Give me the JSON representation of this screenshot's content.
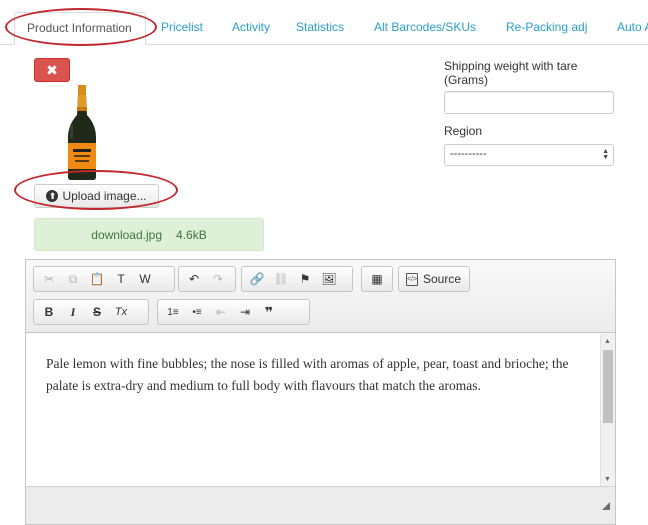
{
  "tabs": [
    {
      "label": "Product Information",
      "active": true
    },
    {
      "label": "Pricelist"
    },
    {
      "label": "Activity"
    },
    {
      "label": "Statistics"
    },
    {
      "label": "Alt Barcodes/SKUs"
    },
    {
      "label": "Re-Packing adj"
    },
    {
      "label": "Auto A"
    }
  ],
  "delete_button": {
    "icon": "close-icon",
    "glyph": "✖"
  },
  "upload": {
    "label": "Upload image...",
    "icon": "arrow-up-circle-icon",
    "glyph": "⬆"
  },
  "file": {
    "name": "download.jpg",
    "size": "4.6kB"
  },
  "fields": {
    "shipping_label_line1": "Shipping weight with tare",
    "shipping_label_line2": "(Grams)",
    "shipping_value": "",
    "region_label": "Region",
    "region_selected": "----------"
  },
  "toolbar": {
    "cut": "✂",
    "copy": "⧉",
    "paste": "📋",
    "paste_text": "T",
    "paste_word": "W",
    "undo": "↶",
    "redo": "↷",
    "link": "🔗",
    "unlink": "⛓",
    "anchor": "⚑",
    "image": "🖼",
    "table": "▦",
    "source_label": "Source",
    "source_icon": "</>",
    "bold": "B",
    "italic": "I",
    "strike": "S",
    "remove_format": "Tx",
    "numbered_list": "1≡",
    "bullet_list": "•≡",
    "outdent": "⇤",
    "indent": "⇥",
    "blockquote": "❞"
  },
  "editor": {
    "text": "Pale lemon with fine bubbles; the nose is filled with aromas of apple, pear, toast and brioche; the palate is extra-dry and medium to full body with flavours that match the aromas."
  },
  "colors": {
    "accent_red": "#c1272d",
    "link_blue": "#2a9fc9",
    "danger": "#d9534f",
    "success_bg": "#dff0d8"
  }
}
